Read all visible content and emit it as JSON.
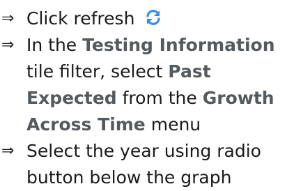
{
  "steps": [
    {
      "arrow": "⇒",
      "text": "Click refresh",
      "icon": "refresh-icon"
    },
    {
      "arrow": "⇒",
      "parts": [
        "In the ",
        "Testing Information",
        " tile filter, select ",
        "Past Expected",
        " from the ",
        "Growth Across Time",
        " menu"
      ]
    },
    {
      "arrow": "⇒",
      "text": "Select the year using radio button below the graph"
    }
  ],
  "colors": {
    "icon": "#3b8ee8",
    "bold_text": "#555a5f"
  }
}
